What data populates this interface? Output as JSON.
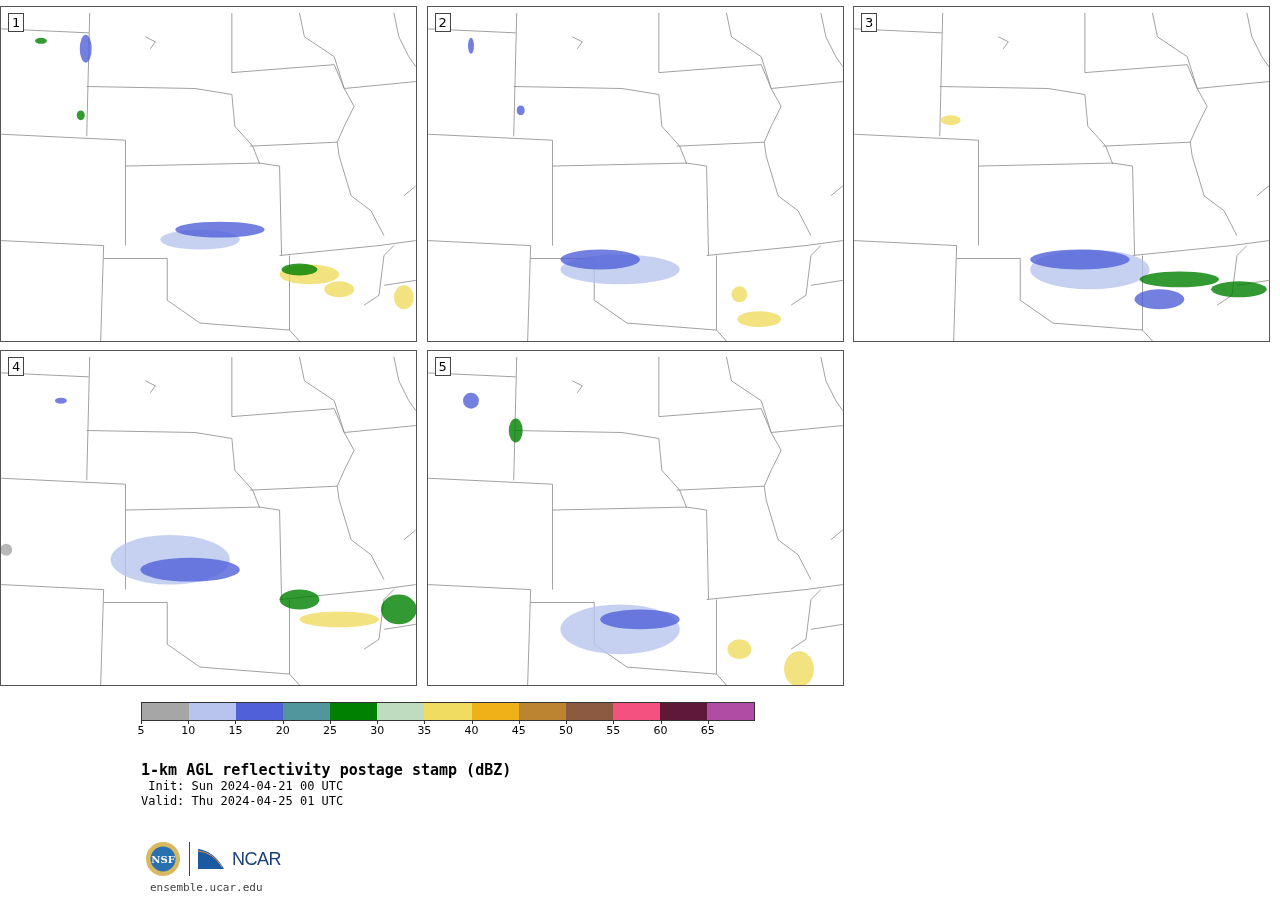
{
  "panels": [
    {
      "label": "1"
    },
    {
      "label": "2"
    },
    {
      "label": "3"
    },
    {
      "label": "4"
    },
    {
      "label": "5"
    }
  ],
  "colorbar": {
    "segments": [
      {
        "color": "#a6a6a6"
      },
      {
        "color": "#b8c4ee"
      },
      {
        "color": "#5060d8"
      },
      {
        "color": "#50969c"
      },
      {
        "color": "#008000"
      },
      {
        "color": "#c0dcc0"
      },
      {
        "color": "#f0dc60"
      },
      {
        "color": "#f0b018"
      },
      {
        "color": "#bc8430"
      },
      {
        "color": "#8c5a40"
      },
      {
        "color": "#f45080"
      },
      {
        "color": "#601838"
      },
      {
        "color": "#b04ca4"
      }
    ],
    "ticks": [
      "5",
      "10",
      "15",
      "20",
      "25",
      "30",
      "35",
      "40",
      "45",
      "50",
      "55",
      "60",
      "65"
    ]
  },
  "title": "1-km AGL reflectivity postage stamp (dBZ)",
  "init": " Init: Sun 2024-04-21 00 UTC",
  "valid": "Valid: Thu 2024-04-25 01 UTC",
  "logo": {
    "nsf": "NSF",
    "ncar": "NCAR"
  },
  "site": "ensemble.ucar.edu"
}
